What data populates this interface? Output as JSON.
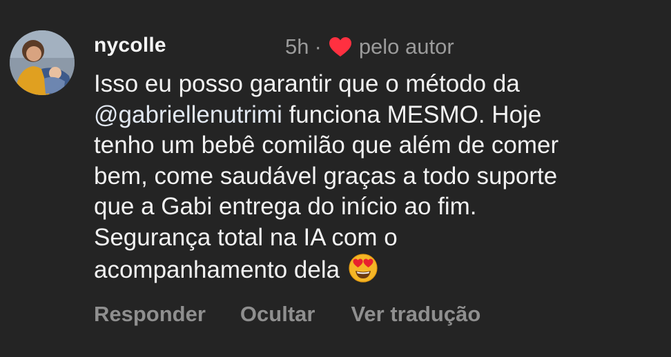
{
  "comment": {
    "username": "nycolle",
    "time": "5h",
    "separator": "·",
    "liked_label": "pelo autor",
    "heart_color": "#ff3040",
    "avatar_icon": "profile-photo",
    "emoji_icon": "smiling-face-with-heart-eyes-icon",
    "text_lines": [
      {
        "mention": "",
        "text": "Isso eu posso garantir que o método da"
      },
      {
        "mention": "@gabriellenutrimi",
        "text": " funciona MESMO. Hoje"
      },
      {
        "mention": "",
        "text": "tenho um bebê comilão que além de comer"
      },
      {
        "mention": "",
        "text": "bem, come saudável graças a todo suporte"
      },
      {
        "mention": "",
        "text": "que a Gabi entrega do início ao fim."
      },
      {
        "mention": "",
        "text": "Segurança total na IA com o"
      },
      {
        "mention": "",
        "text": "acompanhamento dela"
      }
    ]
  },
  "actions": {
    "reply": "Responder",
    "hide": "Ocultar",
    "translate": "Ver tradução"
  },
  "colors": {
    "background": "#242424",
    "text": "#f2f2f2",
    "muted": "#9b9b9b"
  }
}
